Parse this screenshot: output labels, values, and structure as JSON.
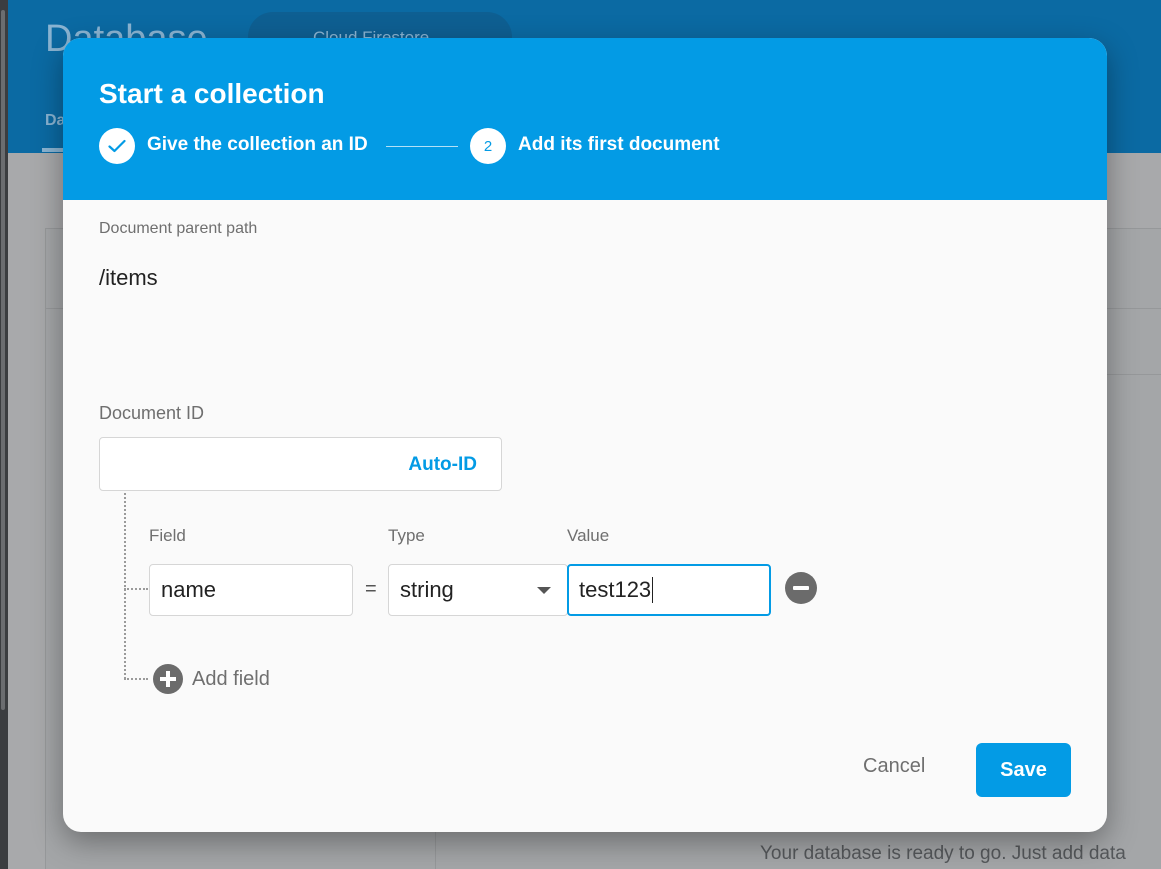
{
  "background": {
    "app_title": "Database",
    "db_selector": "Cloud Firestore",
    "tab_label": "Da",
    "ready_message": "Your database is ready to go. Just add data"
  },
  "dialog": {
    "title": "Start a collection",
    "steps": [
      {
        "label": "Give the collection an ID",
        "status": "completed",
        "icon": "check-icon"
      },
      {
        "number": "2",
        "label": "Add its first document",
        "status": "active"
      }
    ],
    "parent_path_label": "Document parent path",
    "parent_path": "/items",
    "document_id_label": "Document ID",
    "document_id_value": "",
    "auto_id_label": "Auto-ID",
    "columns": {
      "field": "Field",
      "type": "Type",
      "value": "Value"
    },
    "row": {
      "field": "name",
      "equals": "=",
      "type": "string",
      "value": "test123"
    },
    "add_field_label": "Add field",
    "cancel_label": "Cancel",
    "save_label": "Save"
  },
  "colors": {
    "accent": "#039be5",
    "header": "#039be5",
    "icon_gray": "#6b6b6b"
  }
}
